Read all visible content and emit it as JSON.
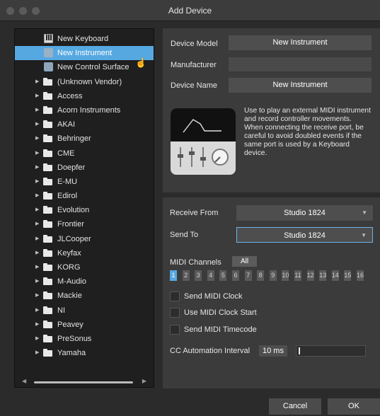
{
  "window": {
    "title": "Add Device"
  },
  "tree": {
    "items": [
      {
        "label": "New Keyboard",
        "type": "keyboard"
      },
      {
        "label": "New Instrument",
        "type": "instrument",
        "selected": true
      },
      {
        "label": "New Control Surface",
        "type": "control"
      },
      {
        "label": "(Unknown Vendor)",
        "type": "folder"
      },
      {
        "label": "Access",
        "type": "folder"
      },
      {
        "label": "Acorn Instruments",
        "type": "folder"
      },
      {
        "label": "AKAI",
        "type": "folder"
      },
      {
        "label": "Behringer",
        "type": "folder"
      },
      {
        "label": "CME",
        "type": "folder"
      },
      {
        "label": "Doepfer",
        "type": "folder"
      },
      {
        "label": "E-MU",
        "type": "folder"
      },
      {
        "label": "Edirol",
        "type": "folder"
      },
      {
        "label": "Evolution",
        "type": "folder"
      },
      {
        "label": "Frontier",
        "type": "folder"
      },
      {
        "label": "JLCooper",
        "type": "folder"
      },
      {
        "label": "Keyfax",
        "type": "folder"
      },
      {
        "label": "KORG",
        "type": "folder"
      },
      {
        "label": "M-Audio",
        "type": "folder"
      },
      {
        "label": "Mackie",
        "type": "folder"
      },
      {
        "label": "NI",
        "type": "folder"
      },
      {
        "label": "Peavey",
        "type": "folder"
      },
      {
        "label": "PreSonus",
        "type": "folder"
      },
      {
        "label": "Yamaha",
        "type": "folder"
      }
    ]
  },
  "device": {
    "model_label": "Device Model",
    "model_value": "New Instrument",
    "manufacturer_label": "Manufacturer",
    "manufacturer_value": "",
    "name_label": "Device Name",
    "name_value": "New Instrument",
    "description": "Use to play an external MIDI instrument and record controller movements. When connecting the receive port, be careful to avoid doubled events if the same port is used by a Keyboard device."
  },
  "ports": {
    "receive_label": "Receive From",
    "receive_value": "Studio 1824",
    "send_label": "Send To",
    "send_value": "Studio 1824"
  },
  "midi": {
    "channels_label": "MIDI Channels",
    "all_label": "All",
    "channels": [
      "1",
      "2",
      "3",
      "4",
      "5",
      "6",
      "7",
      "8",
      "9",
      "10",
      "11",
      "12",
      "13",
      "14",
      "15",
      "16"
    ],
    "active_channel": 1,
    "send_clock_label": "Send MIDI Clock",
    "clock_start_label": "Use MIDI Clock Start",
    "timecode_label": "Send MIDI Timecode",
    "cc_label": "CC Automation Interval",
    "cc_value": "10 ms"
  },
  "footer": {
    "cancel": "Cancel",
    "ok": "OK"
  }
}
